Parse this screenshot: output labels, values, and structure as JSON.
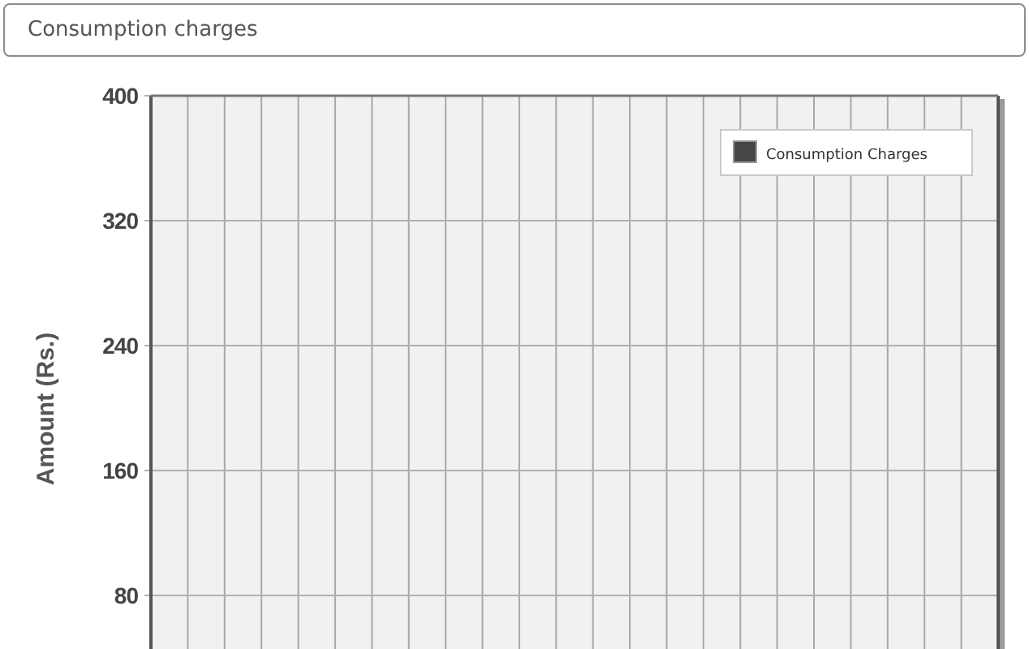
{
  "panel": {
    "title": "Consumption charges"
  },
  "chart": {
    "chart_data": {
      "type": "bar",
      "ylabel": "Amount (Rs.)",
      "ylim": [
        0,
        400
      ],
      "yticks": [
        80,
        160,
        240,
        320,
        400
      ],
      "grid": true,
      "series": [
        {
          "name": "Consumption Charges",
          "color": "#464646"
        }
      ]
    }
  }
}
